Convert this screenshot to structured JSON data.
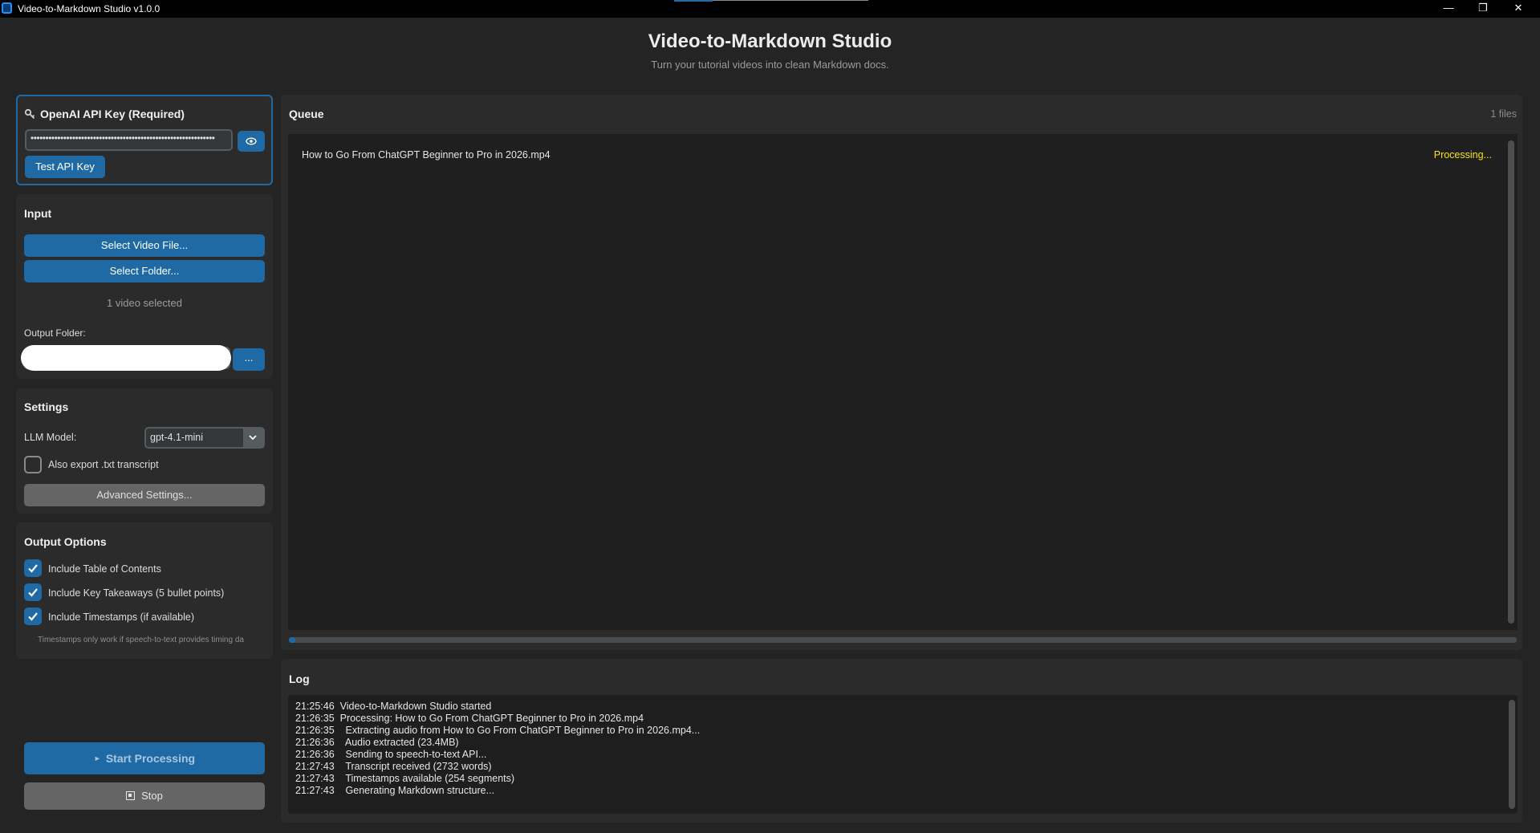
{
  "window": {
    "title": "Video-to-Markdown Studio v1.0.0",
    "min_glyph": "—",
    "max_glyph": "❐",
    "close_glyph": "✕"
  },
  "header": {
    "title": "Video-to-Markdown Studio",
    "subtitle": "Turn your tutorial videos into clean Markdown docs."
  },
  "api_key": {
    "title": "OpenAI API Key (Required)",
    "value": "••••••••••••••••••••••••••••••••••••••••••••••••••••••••••••••",
    "test_label": "Test API Key"
  },
  "input": {
    "title": "Input",
    "select_file_label": "Select Video File...",
    "select_folder_label": "Select Folder...",
    "selected_count": "1 video selected",
    "output_folder_label": "Output Folder:",
    "output_folder_value": "",
    "browse_label": "..."
  },
  "settings": {
    "title": "Settings",
    "model_label": "LLM Model:",
    "model_value": "gpt-4.1-mini",
    "export_txt_label": "Also export .txt transcript",
    "export_txt_checked": false,
    "advanced_label": "Advanced Settings..."
  },
  "output_options": {
    "title": "Output Options",
    "toc_label": "Include Table of Contents",
    "takeaways_label": "Include Key Takeaways (5 bullet points)",
    "timestamps_label": "Include Timestamps (if available)",
    "note": "Timestamps only work if speech-to-text provides timing da"
  },
  "actions": {
    "start_label": "Start Processing",
    "stop_label": "Stop"
  },
  "queue": {
    "title": "Queue",
    "count": "1 files",
    "items": [
      {
        "name": "How to Go From ChatGPT Beginner to Pro in 2026.mp4",
        "status": "Processing..."
      }
    ],
    "progress": 0.005
  },
  "log": {
    "title": "Log",
    "lines": [
      "21:25:46  Video-to-Markdown Studio started",
      "21:26:35  Processing: How to Go From ChatGPT Beginner to Pro in 2026.mp4",
      "21:26:35    Extracting audio from How to Go From ChatGPT Beginner to Pro in 2026.mp4...",
      "21:26:36    Audio extracted (23.4MB)",
      "21:26:36    Sending to speech-to-text API...",
      "21:27:43    Transcript received (2732 words)",
      "21:27:43    Timestamps available (254 segments)",
      "21:27:43    Generating Markdown structure..."
    ]
  },
  "colors": {
    "accent": "#1f6aa5",
    "processing": "#f5e51a",
    "background": "#242424",
    "panel": "#2b2b2b"
  }
}
